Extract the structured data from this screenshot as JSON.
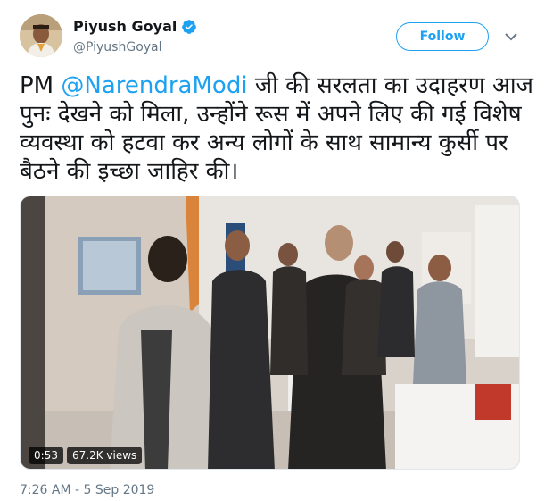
{
  "user": {
    "display_name": "Piyush Goyal",
    "handle": "@PiyushGoyal",
    "verified": true
  },
  "header": {
    "follow_label": "Follow",
    "menu_icon": "chevron-down-icon"
  },
  "tweet": {
    "prefix": "PM ",
    "mention": "@NarendraModi",
    "body": " जी की सरलता का उदाहरण आज पुनः देखने को मिला, उन्होंने रूस में अपने लिए की गई विशेष व्यवस्था को हटवा कर अन्य लोगों के साथ सामान्य कुर्सी पर बैठने की इच्छा जाहिर की।"
  },
  "video": {
    "duration": "0:53",
    "views": "67.2K views"
  },
  "timestamp": "7:26 AM - 5 Sep 2019",
  "colors": {
    "accent": "#1da1f2",
    "secondary_text": "#657786"
  }
}
